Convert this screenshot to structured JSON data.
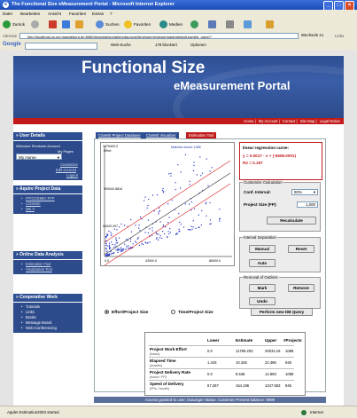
{
  "window": {
    "title": "The Functional Size eMeasurement Portal - Microsoft Internet Explorer",
    "menu": [
      "Datei",
      "Bearbeiten",
      "Ansicht",
      "Favoriten",
      "Extras",
      "?"
    ],
    "toolbar": [
      "Zurück",
      "Suchen",
      "Favoriten",
      "Medien"
    ],
    "address_label": "Adresse",
    "address": "http://localhost.cs.uni-magdeburg.de:8080/template/portal/media-type/html/user/reviewer/page/default.psml/js_pane/?",
    "go": "Wechseln zu",
    "links": "Links",
    "google_items": [
      "Web-Suche",
      "178 blockiert",
      "Optionen"
    ]
  },
  "banner": {
    "title": "Functional Size",
    "subtitle": "eMeasurement Portal"
  },
  "topnav": [
    "Home",
    "My Account",
    "Contact",
    "Site Map",
    "Legal Notice"
  ],
  "sidebar": {
    "user_details": {
      "heading": "» User Details",
      "welcome": "Welcome Reviewer Account",
      "my_pages": "My Pages",
      "select_value": "My Home",
      "links": [
        "Customize",
        "Edit account",
        "Logout"
      ]
    },
    "acquire": {
      "heading": "» Aquire Project Data",
      "items": [
        "FP/COSMIC-FFP",
        "COSMIC",
        "MK II"
      ]
    },
    "analysis": {
      "heading": "» Online Data Analysis",
      "items": [
        "Estimation Tool",
        "Visulization Tool"
      ]
    },
    "cooperative": {
      "heading": "» Cooperative Work",
      "items": [
        "Tutorials",
        "Links",
        "Books",
        "Message Board",
        "Web-Conferencing"
      ]
    }
  },
  "tabs": [
    "CSeMS Project Database",
    "CSeMS Visualizer",
    "Estimation Tool"
  ],
  "plot": {
    "y_top_label": "Effort",
    "y_labels": [
      "1875400.0",
      "900042.8816",
      "54420.257"
    ],
    "x_labels": [
      "0.0",
      "43000.0",
      "86000.0"
    ],
    "matches": "Matches found: 1088"
  },
  "regression": {
    "heading": "linear regression curve:",
    "equation": "y = 0.0017 · x + (-5508.0001)",
    "r2": "R2 = 0.197"
  },
  "customize": {
    "title": "Customize Calculation",
    "conf_label": "Conf. Interval:",
    "conf_value": "90%",
    "size_label": "Project Size (FP):",
    "size_value": "1,000",
    "recalc": "Recalculate"
  },
  "interval": {
    "title": "Interval Separation",
    "manual": "Manual",
    "reset": "Reset",
    "auto": "Auto"
  },
  "outliers": {
    "title": "Removal of Outliers",
    "mark": "Mark",
    "remove": "Remove",
    "undo": "Undo"
  },
  "mode": {
    "option1": "Effort/Project Size",
    "option2": "Time/Project Size",
    "query_button": "Perform new DB Query"
  },
  "results": {
    "headers": [
      "Lower",
      "Estimate",
      "Upper",
      "#Projects"
    ],
    "rows": [
      {
        "label": "Project Work Effort",
        "unit": "(hours)",
        "values": [
          "0.0",
          "11769.203",
          "20034.16",
          "1088"
        ]
      },
      {
        "label": "Elapsed Time",
        "unit": "(months)",
        "values": [
          "1.443",
          "10.346",
          "22.486",
          "946"
        ]
      },
      {
        "label": "Project Delivery Rate",
        "unit": "(hours / FP)",
        "values": [
          "0.0",
          "8.536",
          "14.893",
          "1088"
        ]
      },
      {
        "label": "Speed of Delivery",
        "unit": "(FPs / month)",
        "values": [
          "67.287",
          "154.186",
          "1247.553",
          "946"
        ]
      }
    ]
  },
  "footer": "Access granted to user: bnaunger    Status: Customer    Present balance: 9999",
  "statusbar": {
    "left": "Applet Estimation2003 started",
    "zone": "Internet"
  }
}
